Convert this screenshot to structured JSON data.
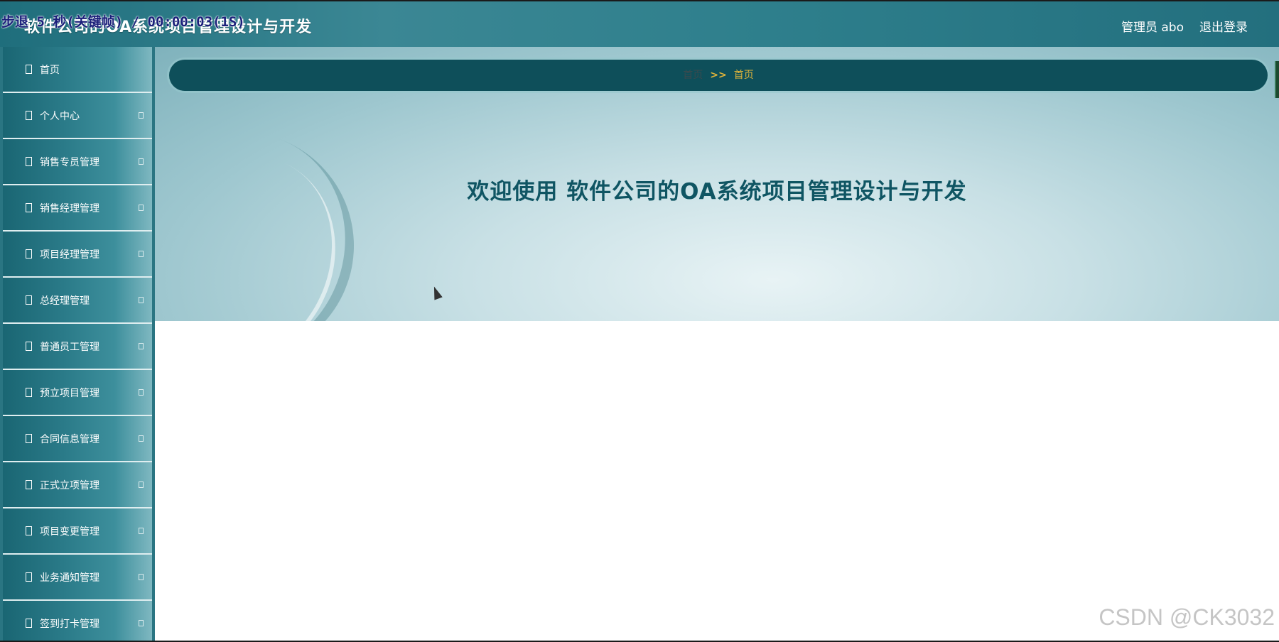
{
  "header": {
    "title": "软件公司的OA系统项目管理设计与开发",
    "overlay_text": "步退 5 秒(关键帧) / 00:00:03(1S)",
    "user": "管理员 abo",
    "logout": "退出登录"
  },
  "sidebar": {
    "items": [
      {
        "label": "首页"
      },
      {
        "label": "个人中心"
      },
      {
        "label": "销售专员管理"
      },
      {
        "label": "销售经理管理"
      },
      {
        "label": "项目经理管理"
      },
      {
        "label": "总经理管理"
      },
      {
        "label": "普通员工管理"
      },
      {
        "label": "预立项目管理"
      },
      {
        "label": "合同信息管理"
      },
      {
        "label": "正式立项管理"
      },
      {
        "label": "项目变更管理"
      },
      {
        "label": "业务通知管理"
      },
      {
        "label": "签到打卡管理"
      }
    ]
  },
  "breadcrumb": {
    "home": "首页",
    "separator": ">>",
    "current": "首页"
  },
  "welcome": "欢迎使用 软件公司的OA系统项目管理设计与开发",
  "watermark": "CSDN @CK3032",
  "colors": {
    "header": "#2e7f8c",
    "crumb_bg": "#0e4f5a",
    "accent": "#e0b43a",
    "welcome_text": "#0f5563"
  }
}
